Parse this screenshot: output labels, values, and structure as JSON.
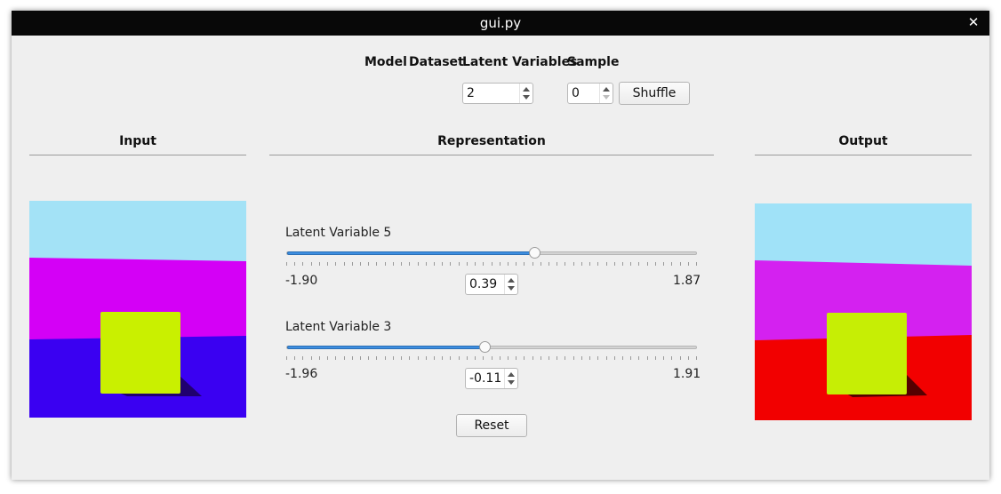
{
  "window": {
    "title": "gui.py"
  },
  "top_headers": {
    "model": "Model",
    "dataset": "Dataset",
    "latent_variables": "Latent Variables",
    "sample": "Sample"
  },
  "latent_spin": {
    "value": "2"
  },
  "sample_spin": {
    "value": "0"
  },
  "shuffle_label": "Shuffle",
  "sections": {
    "input": "Input",
    "representation": "Representation",
    "output": "Output"
  },
  "latents": [
    {
      "label": "Latent Variable 5",
      "min": "-1.90",
      "max": "1.87",
      "value": "0.39",
      "fraction": 0.605
    },
    {
      "label": "Latent Variable 3",
      "min": "-1.96",
      "max": "1.91",
      "value": "-0.11",
      "fraction": 0.482
    }
  ],
  "reset_label": "Reset",
  "images": {
    "input": {
      "sky": "#a3e2f6",
      "wall": "#d400f6",
      "floor": "#3a00f2",
      "cube": "#c9f000"
    },
    "output": {
      "sky": "#a0e2f8",
      "wall": "#d421f0",
      "floor": "#f20000",
      "cube": "#c6ee05"
    }
  }
}
